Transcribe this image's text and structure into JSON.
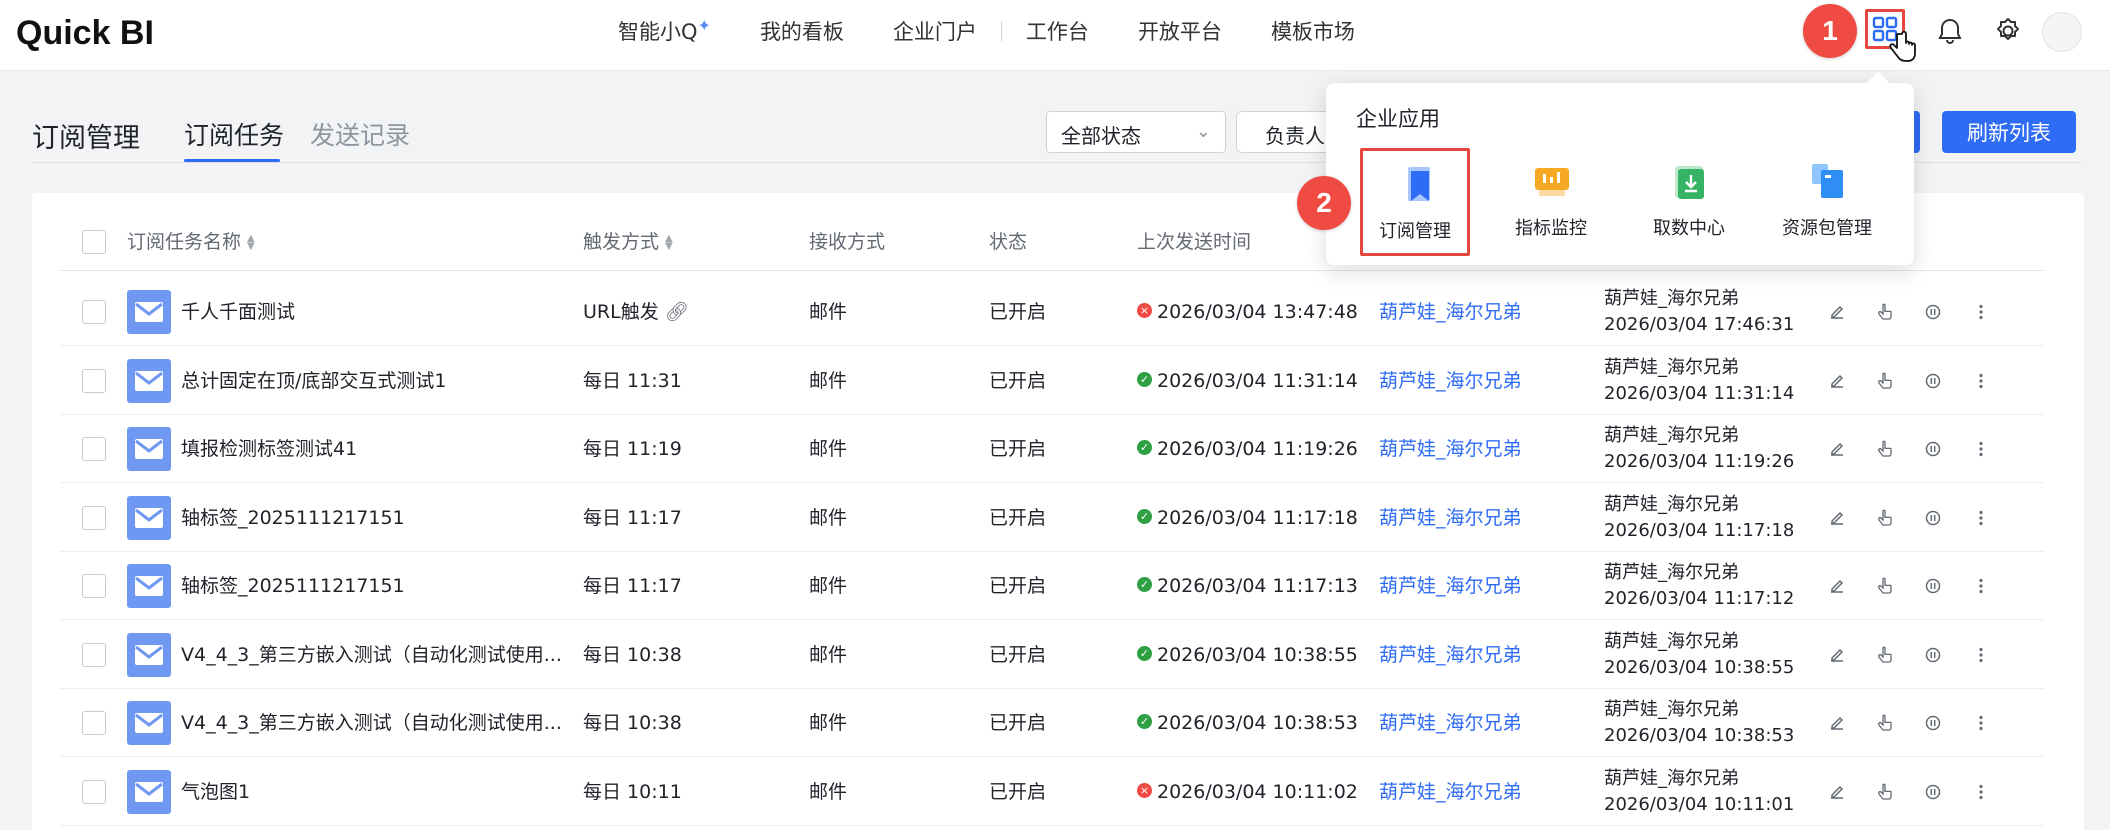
{
  "brand": {
    "logo": "Quick BI"
  },
  "topnav": {
    "items": [
      "智能小Q",
      "我的看板",
      "企业门户",
      "工作台",
      "开放平台",
      "模板市场"
    ]
  },
  "callouts": {
    "one": "1",
    "two": "2"
  },
  "page": {
    "title": "订阅管理",
    "tabs": [
      {
        "label": "订阅任务",
        "active": true
      },
      {
        "label": "发送记录",
        "active": false
      }
    ],
    "filter_status": "全部状态",
    "filter_owner": "负责人",
    "refresh_label": "刷新列表"
  },
  "popover": {
    "title": "企业应用",
    "apps": [
      {
        "label": "订阅管理",
        "icon": "bookmark-icon",
        "selected": true
      },
      {
        "label": "指标监控",
        "icon": "monitor-icon",
        "selected": false
      },
      {
        "label": "取数中心",
        "icon": "download-icon",
        "selected": false
      },
      {
        "label": "资源包管理",
        "icon": "package-icon",
        "selected": false
      }
    ]
  },
  "table": {
    "columns": [
      "订阅任务名称",
      "触发方式",
      "接收方式",
      "状态",
      "上次发送时间"
    ],
    "rows": [
      {
        "name": "千人千面测试",
        "trigger": "URL触发",
        "receive": "邮件",
        "state": "已开启",
        "last_ok": false,
        "last_time": "2026/03/04 13:47:48",
        "owner": "葫芦娃_海尔兄弟",
        "mod_user": "葫芦娃_海尔兄弟",
        "mod_time": "2026/03/04 17:46:31"
      },
      {
        "name": "总计固定在顶/底部交互式测试1",
        "trigger": "每日 11:31",
        "receive": "邮件",
        "state": "已开启",
        "last_ok": true,
        "last_time": "2026/03/04 11:31:14",
        "owner": "葫芦娃_海尔兄弟",
        "mod_user": "葫芦娃_海尔兄弟",
        "mod_time": "2026/03/04 11:31:14"
      },
      {
        "name": "填报检测标签测试41",
        "trigger": "每日 11:19",
        "receive": "邮件",
        "state": "已开启",
        "last_ok": true,
        "last_time": "2026/03/04 11:19:26",
        "owner": "葫芦娃_海尔兄弟",
        "mod_user": "葫芦娃_海尔兄弟",
        "mod_time": "2026/03/04 11:19:26"
      },
      {
        "name": "轴标签_2025111217151",
        "trigger": "每日 11:17",
        "receive": "邮件",
        "state": "已开启",
        "last_ok": true,
        "last_time": "2026/03/04 11:17:18",
        "owner": "葫芦娃_海尔兄弟",
        "mod_user": "葫芦娃_海尔兄弟",
        "mod_time": "2026/03/04 11:17:18"
      },
      {
        "name": "轴标签_2025111217151",
        "trigger": "每日 11:17",
        "receive": "邮件",
        "state": "已开启",
        "last_ok": true,
        "last_time": "2026/03/04 11:17:13",
        "owner": "葫芦娃_海尔兄弟",
        "mod_user": "葫芦娃_海尔兄弟",
        "mod_time": "2026/03/04 11:17:12"
      },
      {
        "name": "V4_4_3_第三方嵌入测试（自动化测试使用...",
        "trigger": "每日 10:38",
        "receive": "邮件",
        "state": "已开启",
        "last_ok": true,
        "last_time": "2026/03/04 10:38:55",
        "owner": "葫芦娃_海尔兄弟",
        "mod_user": "葫芦娃_海尔兄弟",
        "mod_time": "2026/03/04 10:38:55"
      },
      {
        "name": "V4_4_3_第三方嵌入测试（自动化测试使用...",
        "trigger": "每日 10:38",
        "receive": "邮件",
        "state": "已开启",
        "last_ok": true,
        "last_time": "2026/03/04 10:38:53",
        "owner": "葫芦娃_海尔兄弟",
        "mod_user": "葫芦娃_海尔兄弟",
        "mod_time": "2026/03/04 10:38:53"
      },
      {
        "name": "气泡图1",
        "trigger": "每日 10:11",
        "receive": "邮件",
        "state": "已开启",
        "last_ok": false,
        "last_time": "2026/03/04 10:11:02",
        "owner": "葫芦娃_海尔兄弟",
        "mod_user": "葫芦娃_海尔兄弟",
        "mod_time": "2026/03/04 10:11:01"
      }
    ]
  },
  "colors": {
    "accent": "#2f6cf6",
    "callout": "#ef4b43",
    "ok": "#2ea043",
    "error": "#ef4b43"
  }
}
